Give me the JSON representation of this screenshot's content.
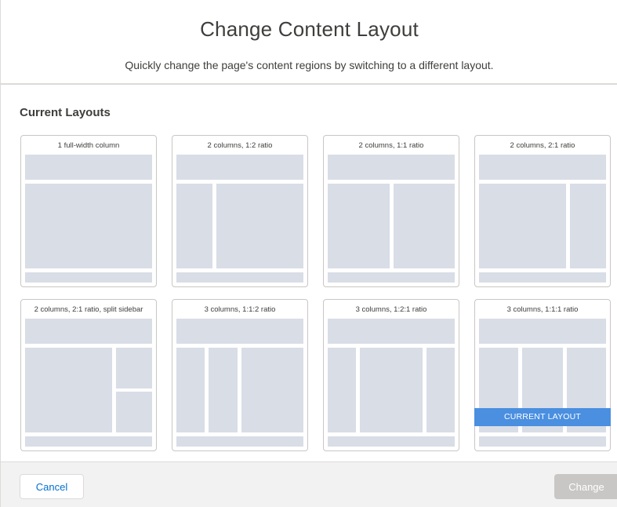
{
  "header": {
    "title": "Change Content Layout",
    "subtitle": "Quickly change the page's content regions by switching to a different layout."
  },
  "section": {
    "title": "Current Layouts"
  },
  "layouts": [
    {
      "label": "1 full-width column"
    },
    {
      "label": "2 columns, 1:2 ratio"
    },
    {
      "label": "2 columns, 1:1 ratio"
    },
    {
      "label": "2 columns, 2:1 ratio"
    },
    {
      "label": "2 columns, 2:1 ratio, split sidebar"
    },
    {
      "label": "3 columns, 1:1:2 ratio"
    },
    {
      "label": "3 columns, 1:2:1 ratio"
    },
    {
      "label": "3 columns, 1:1:1 ratio",
      "badge": "CURRENT LAYOUT"
    }
  ],
  "footer": {
    "cancel_label": "Cancel",
    "change_label": "Change"
  },
  "colors": {
    "region": "#d8dde6",
    "accent": "#4a8fe0",
    "link": "#0070d2",
    "disabled": "#c9c7c5"
  }
}
